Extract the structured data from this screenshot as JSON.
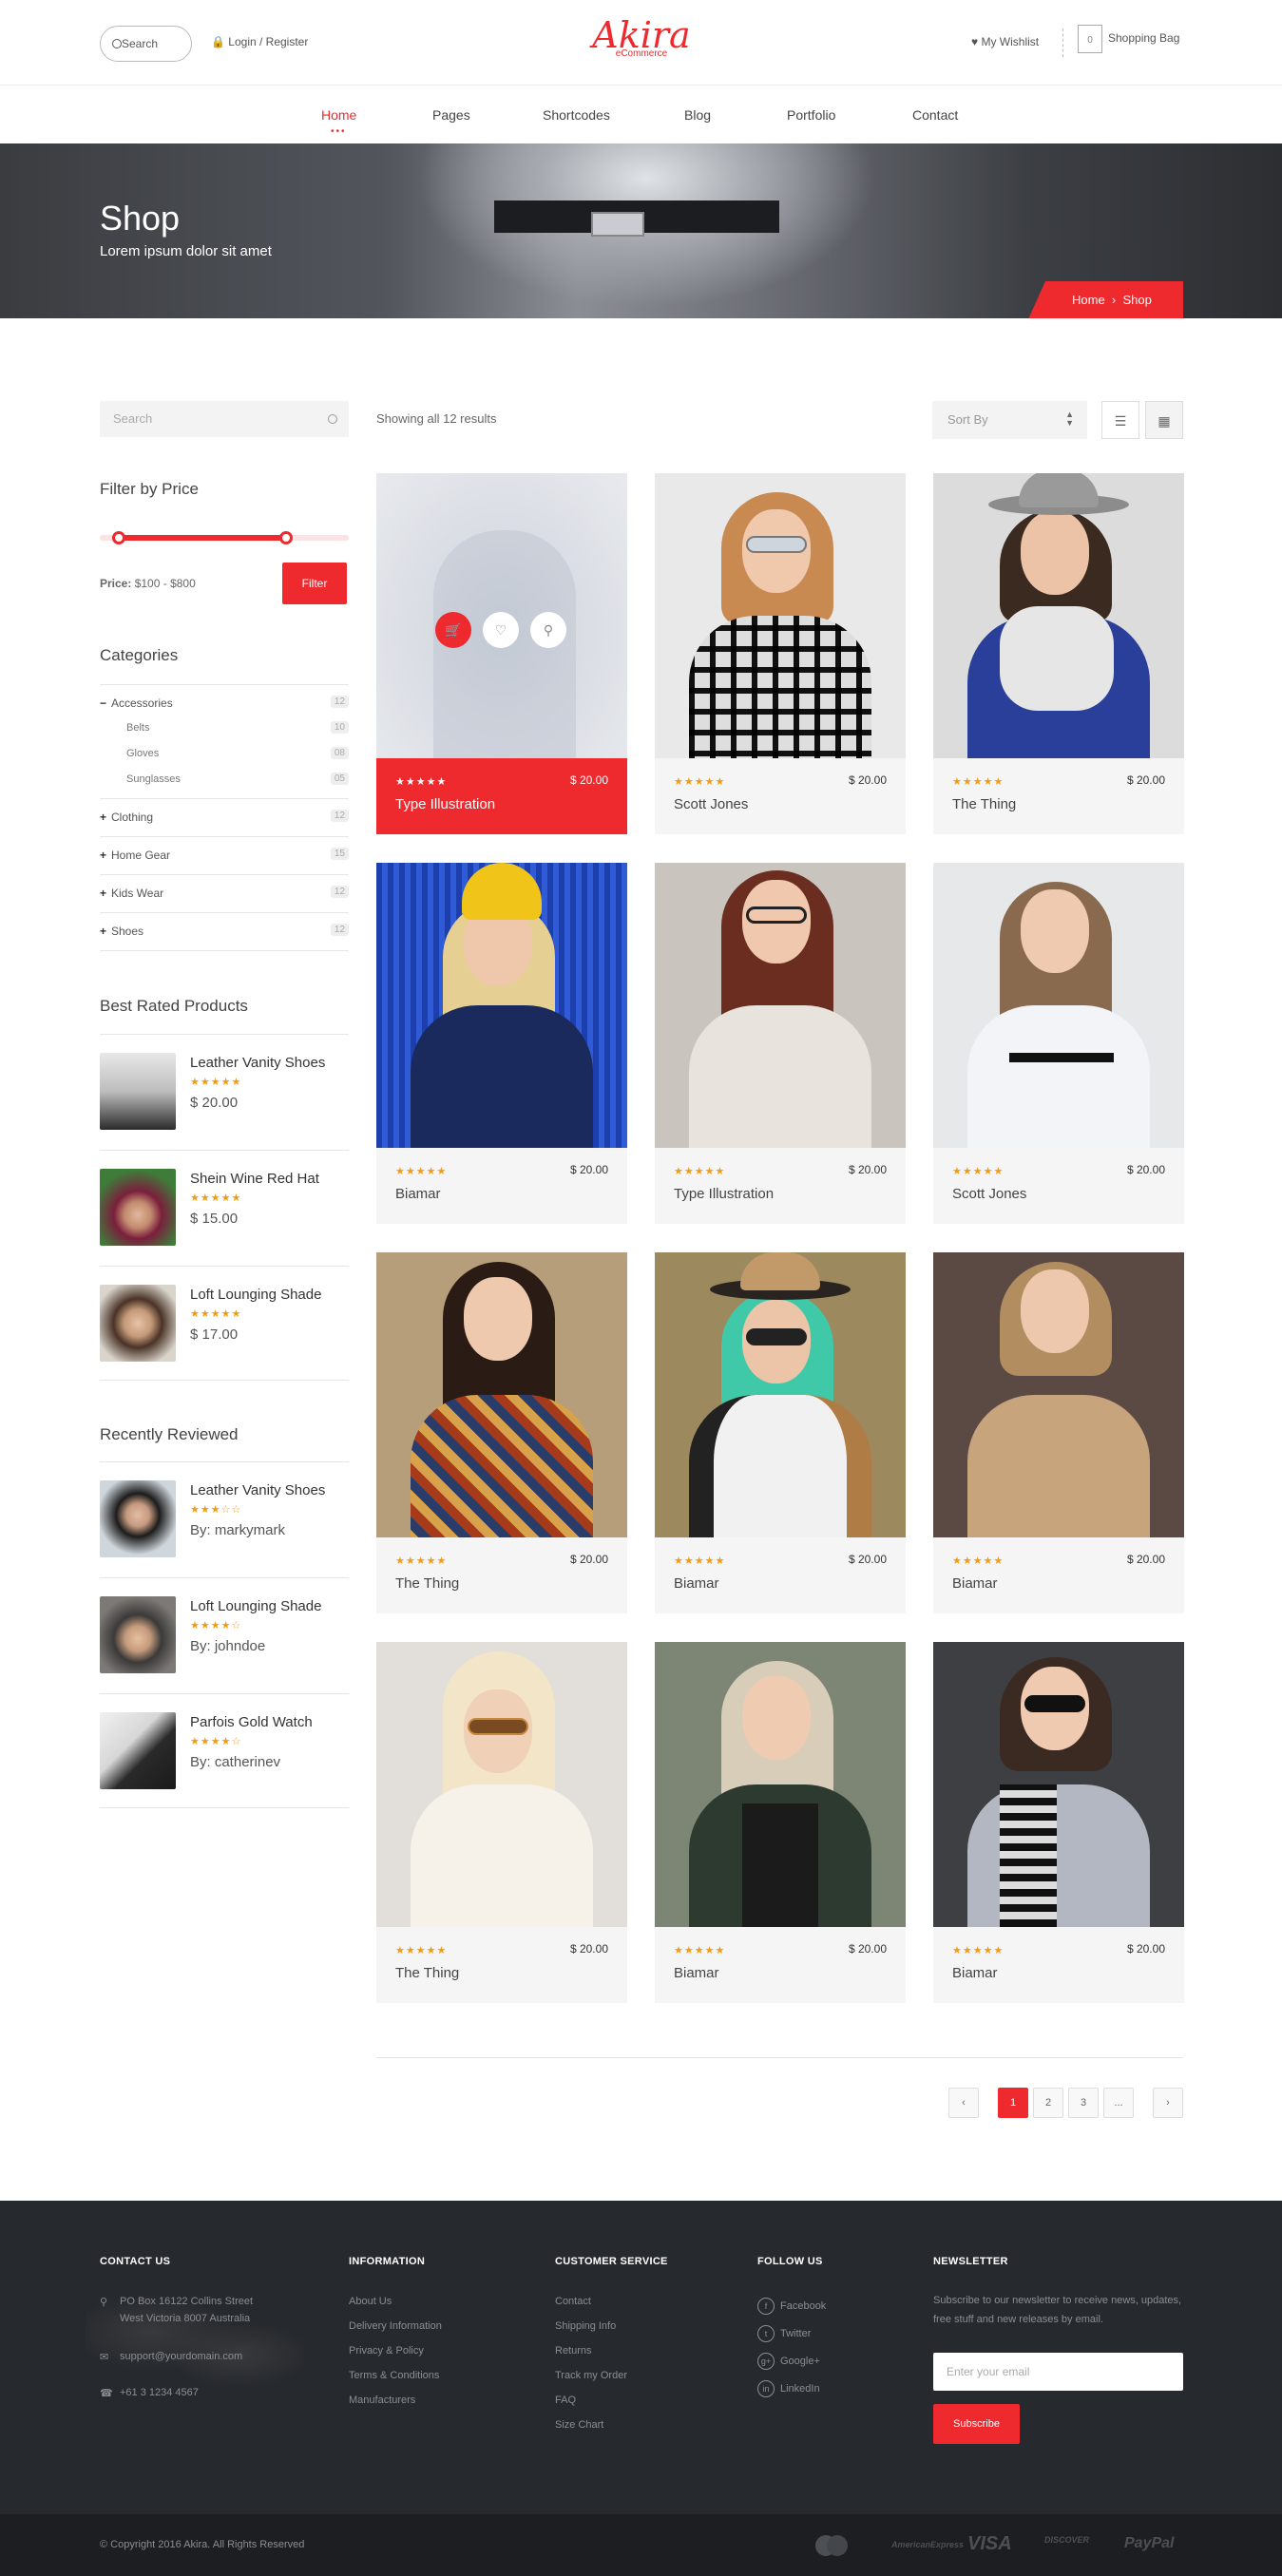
{
  "header": {
    "search_label": "Search",
    "login_label": "Login / Register",
    "logo_main": "Akira",
    "logo_sub": "eCommerce",
    "wishlist_label": "My Wishlist",
    "bag_count": "0",
    "bag_label": "Shopping Bag",
    "nav": [
      {
        "label": "Home"
      },
      {
        "label": "Pages"
      },
      {
        "label": "Shortcodes"
      },
      {
        "label": "Blog"
      },
      {
        "label": "Portfolio"
      },
      {
        "label": "Contact"
      }
    ]
  },
  "hero": {
    "title": "Shop",
    "subtitle": "Lorem ipsum dolor sit amet",
    "breadcrumb_home": "Home",
    "breadcrumb_sep": "›",
    "breadcrumb_current": "Shop"
  },
  "sidebar": {
    "search_placeholder": "Search",
    "filter_title": "Filter by Price",
    "price_label": "Price:",
    "price_range": "$100 - $800",
    "filter_button": "Filter",
    "categories_title": "Categories",
    "categories": [
      {
        "sign": "−",
        "label": "Accessories",
        "count": "12"
      },
      {
        "sign": "+",
        "label": "Clothing",
        "count": "12"
      },
      {
        "sign": "+",
        "label": "Home Gear",
        "count": "15"
      },
      {
        "sign": "+",
        "label": "Kids Wear",
        "count": "12"
      },
      {
        "sign": "+",
        "label": "Shoes",
        "count": "12"
      }
    ],
    "subcategories": [
      {
        "label": "Belts",
        "count": "10"
      },
      {
        "label": "Gloves",
        "count": "08"
      },
      {
        "label": "Sunglasses",
        "count": "05"
      }
    ],
    "best_rated_title": "Best Rated Products",
    "best_rated": [
      {
        "name": "Leather Vanity Shoes",
        "stars": "★★★★★",
        "price": "$ 20.00"
      },
      {
        "name": "Shein Wine Red Hat",
        "stars": "★★★★★",
        "price": "$ 15.00"
      },
      {
        "name": "Loft Lounging Shade",
        "stars": "★★★★★",
        "price": "$ 17.00"
      }
    ],
    "recent_title": "Recently Reviewed",
    "recent": [
      {
        "name": "Leather Vanity Shoes",
        "stars": "★★★☆☆",
        "by": "By: markymark"
      },
      {
        "name": "Loft Lounging Shade",
        "stars": "★★★★☆",
        "by": "By: johndoe"
      },
      {
        "name": "Parfois Gold Watch",
        "stars": "★★★★☆",
        "by": "By: catherinev"
      }
    ]
  },
  "toolbar": {
    "showing": "Showing all 12 results",
    "sort_label": "Sort By"
  },
  "products": [
    {
      "name": "Type Illustration",
      "price": "$ 20.00",
      "stars": "★★★★★"
    },
    {
      "name": "Scott Jones",
      "price": "$ 20.00",
      "stars": "★★★★★"
    },
    {
      "name": "The Thing",
      "price": "$ 20.00",
      "stars": "★★★★★"
    },
    {
      "name": "Biamar",
      "price": "$ 20.00",
      "stars": "★★★★★"
    },
    {
      "name": "Type Illustration",
      "price": "$ 20.00",
      "stars": "★★★★★"
    },
    {
      "name": "Scott Jones",
      "price": "$ 20.00",
      "stars": "★★★★★"
    },
    {
      "name": "The Thing",
      "price": "$ 20.00",
      "stars": "★★★★★"
    },
    {
      "name": "Biamar",
      "price": "$ 20.00",
      "stars": "★★★★★"
    },
    {
      "name": "Biamar",
      "price": "$ 20.00",
      "stars": "★★★★★"
    },
    {
      "name": "The Thing",
      "price": "$ 20.00",
      "stars": "★★★★★"
    },
    {
      "name": "Biamar",
      "price": "$ 20.00",
      "stars": "★★★★★"
    },
    {
      "name": "Biamar",
      "price": "$ 20.00",
      "stars": "★★★★★"
    }
  ],
  "pagination": {
    "prev": "‹",
    "pages": [
      "1",
      "2",
      "3",
      "..."
    ],
    "next": "›"
  },
  "footer": {
    "contact_title": "CONTACT US",
    "address_line1": "PO Box 16122 Collins Street",
    "address_line2": "West Victoria 8007 Australia",
    "email": "support@yourdomain.com",
    "phone": "+61 3 1234 4567",
    "info_title": "INFORMATION",
    "info_links": [
      "About Us",
      "Delivery Information",
      "Privacy & Policy",
      "Terms & Conditions",
      "Manufacturers"
    ],
    "service_title": "CUSTOMER SERVICE",
    "service_links": [
      "Contact",
      "Shipping Info",
      "Returns",
      "Track my Order",
      "FAQ",
      "Size Chart"
    ],
    "follow_title": "FOLLOW US",
    "follow_links": [
      "Facebook",
      "Twitter",
      "Google+",
      "LinkedIn"
    ],
    "newsletter_title": "NEWSLETTER",
    "newsletter_text": "Subscribe to our newsletter to receive news, updates, free stuff and new releases by email.",
    "newsletter_placeholder": "Enter your email",
    "subscribe_label": "Subscribe",
    "copyright": "© Copyright 2016 Akira. All Rights Reserved",
    "payments": [
      "MasterCard",
      "AmericanExpress",
      "VISA",
      "DISCOVER",
      "PayPal"
    ]
  },
  "colors": {
    "accent": "#ee2a2f",
    "star": "#f39c12",
    "footer_bg": "#26292d"
  }
}
